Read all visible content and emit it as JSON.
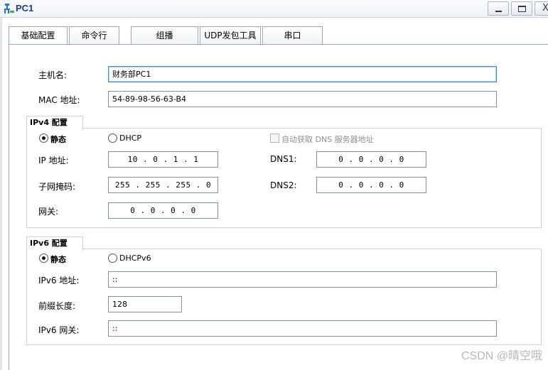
{
  "window": {
    "title": "PC1",
    "close_glyph": "X"
  },
  "tabs": [
    "基础配置",
    "命令行",
    "组播",
    "UDP发包工具",
    "串口"
  ],
  "basic": {
    "hostname_label": "主机名:",
    "hostname_value": "财务部PC1",
    "mac_label": "MAC 地址:",
    "mac_value": "54-89-98-56-63-B4"
  },
  "ipv4": {
    "title": "IPv4 配置",
    "static_label": "静态",
    "dhcp_label": "DHCP",
    "auto_dns_label": "自动获取 DNS 服务器地址",
    "ip_label": "IP 地址:",
    "ip_value": "10 . 0 . 1 . 1",
    "mask_label": "子网掩码:",
    "mask_value": "255 . 255 . 255 . 0",
    "gateway_label": "网关:",
    "gateway_value": "0 . 0 . 0 . 0",
    "dns1_label": "DNS1:",
    "dns1_value": "0 . 0 . 0 . 0",
    "dns2_label": "DNS2:",
    "dns2_value": "0 . 0 . 0 . 0"
  },
  "ipv6": {
    "title": "IPv6 配置",
    "static_label": "静态",
    "dhcp_label": "DHCPv6",
    "ip_label": "IPv6 地址:",
    "ip_value": "::",
    "prefix_label": "前缀长度:",
    "prefix_value": "128",
    "gateway_label": "IPv6 网关:",
    "gateway_value": "::"
  },
  "watermark": "CSDN @晴空哦",
  "icons": {
    "app": "pc-network-icon",
    "minimize": "minimize-icon",
    "maximize": "maximize-icon",
    "close": "close-icon"
  }
}
